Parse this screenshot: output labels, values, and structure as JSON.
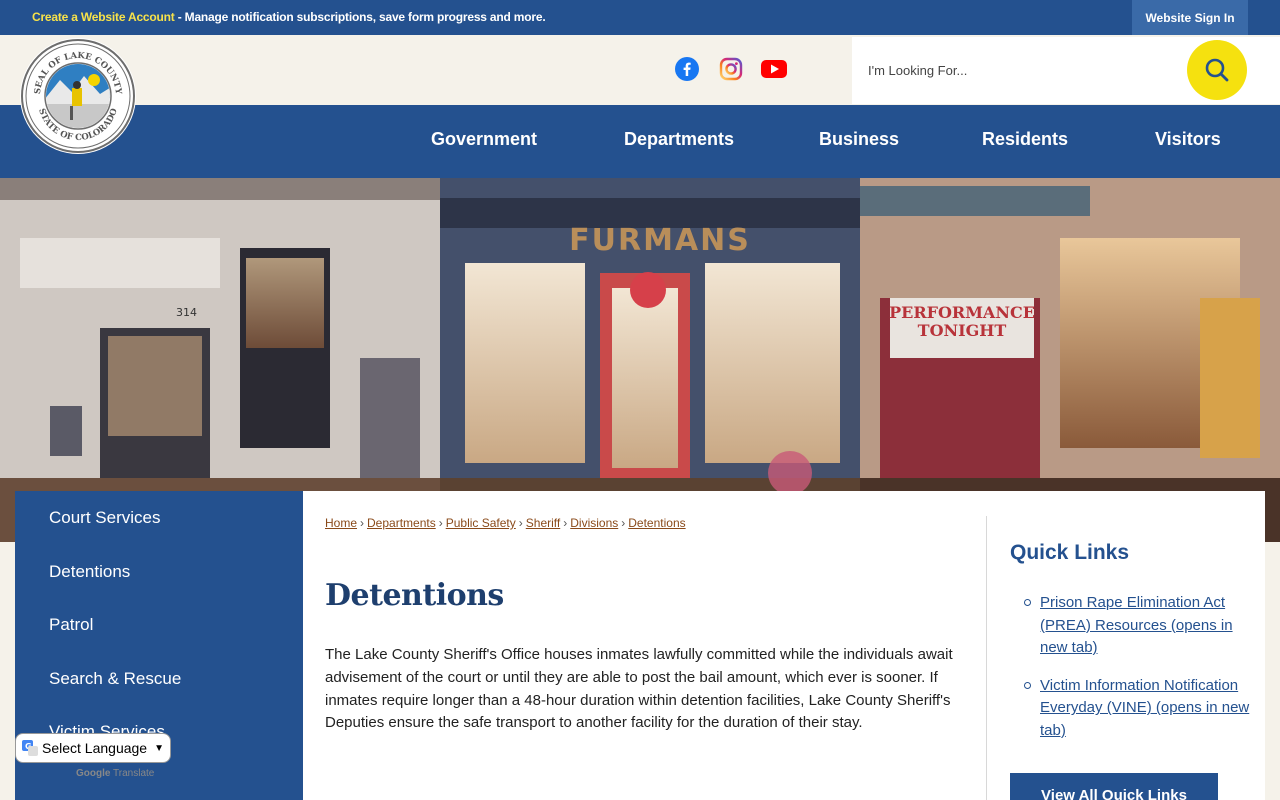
{
  "topbar": {
    "create_account": "Create a Website Account",
    "promo_rest": " - Manage notification subscriptions, save form progress and more.",
    "signin": "Website Sign In"
  },
  "seal": {
    "outer_top": "SEAL OF LAKE COUNTY",
    "outer_bottom": "STATE OF COLORADO"
  },
  "social": [
    {
      "name": "facebook-icon",
      "color": "#1877f2"
    },
    {
      "name": "instagram-icon",
      "color": "#d6249f"
    },
    {
      "name": "youtube-icon",
      "color": "#ff0000"
    }
  ],
  "search": {
    "placeholder": "I'm Looking For..."
  },
  "nav": {
    "items": [
      {
        "label": "Government"
      },
      {
        "label": "Departments"
      },
      {
        "label": "Business"
      },
      {
        "label": "Residents"
      },
      {
        "label": "Visitors"
      }
    ]
  },
  "hero": {
    "sign_furmans": "FURMANS",
    "sign_performance_1": "PERFORMANCE",
    "sign_performance_2": "TONIGHT",
    "address": "314"
  },
  "sidebar": {
    "items": [
      {
        "label": "Court Services"
      },
      {
        "label": "Detentions"
      },
      {
        "label": "Patrol"
      },
      {
        "label": "Search & Rescue"
      },
      {
        "label": "Victim Services"
      }
    ]
  },
  "breadcrumb": [
    {
      "label": "Home"
    },
    {
      "label": "Departments"
    },
    {
      "label": "Public Safety"
    },
    {
      "label": "Sheriff"
    },
    {
      "label": "Divisions"
    },
    {
      "label": "Detentions"
    }
  ],
  "page": {
    "title": "Detentions",
    "body": "The Lake County Sheriff's Office houses inmates lawfully committed while the individuals await advisement of the court or until they are able to post the bail amount, which ever is sooner. If inmates require longer than a 48-hour duration within detention facilities, Lake County Sheriff's Deputies ensure the safe transport to another facility for the duration of their stay."
  },
  "quick_links": {
    "title": "Quick Links",
    "items": [
      {
        "label": "Prison Rape Elimination Act (PREA) Resources (opens in new tab)"
      },
      {
        "label": "Victim Information Notification Everyday (VINE) (opens in new tab)"
      }
    ],
    "view_all": "View All Quick Links"
  },
  "translate": {
    "label": "Select Language",
    "powered_by": "Google",
    "powered_suffix": " Translate"
  },
  "colors": {
    "primary": "#24518f",
    "accent_yellow": "#f5e10f",
    "link_brown": "#8a4a1a"
  }
}
